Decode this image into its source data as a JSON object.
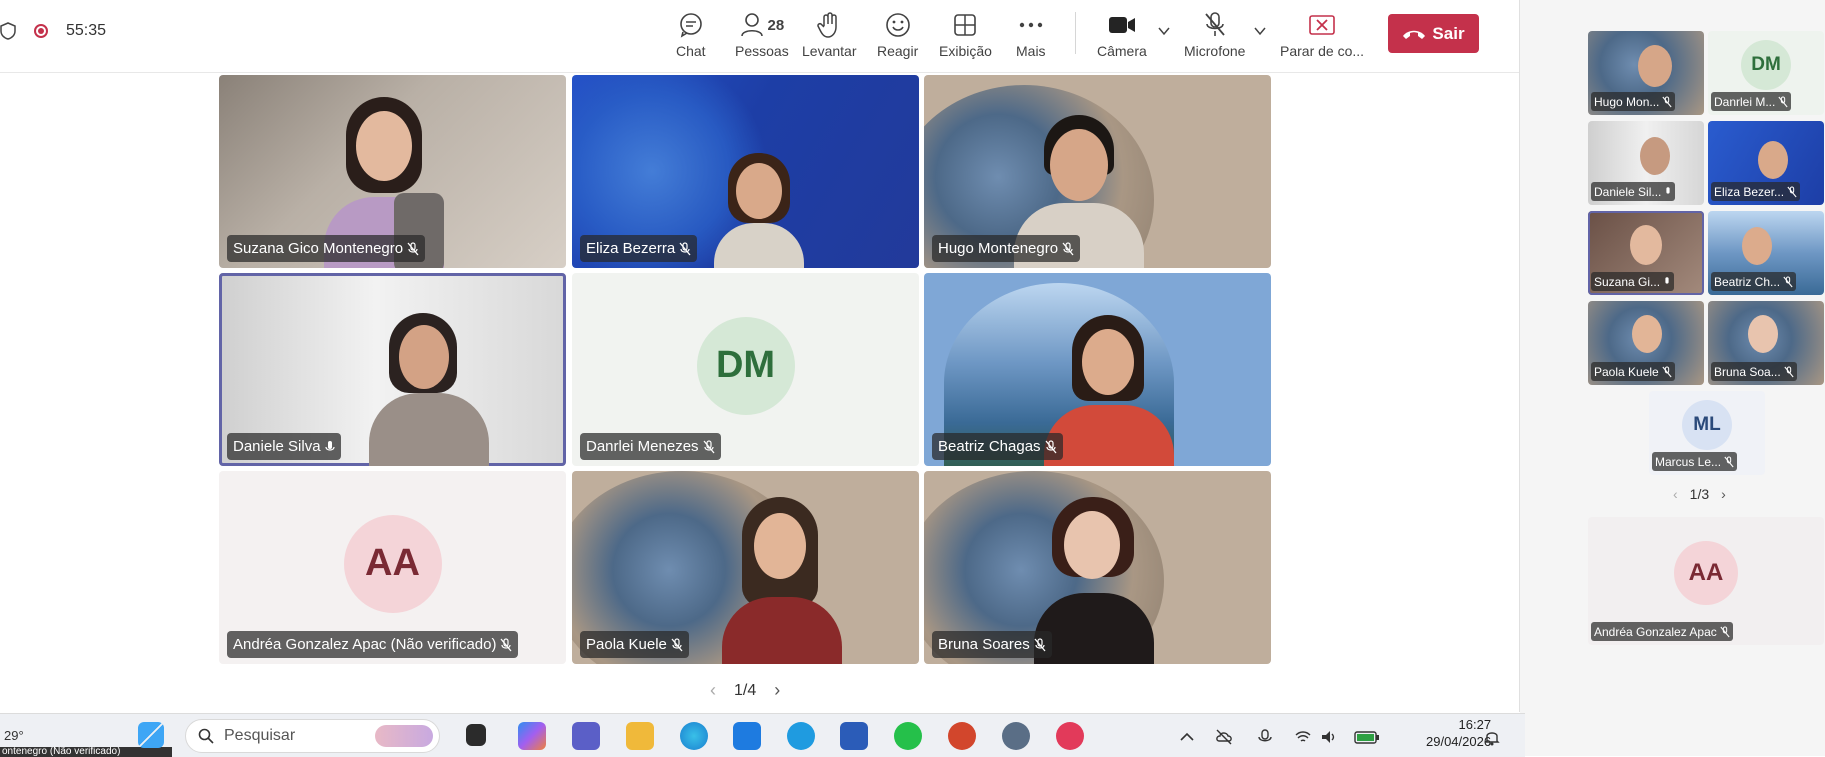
{
  "toolbar": {
    "timer": "55:35",
    "chat_label": "Chat",
    "people_label": "Pessoas",
    "people_count": "28",
    "raise_label": "Levantar",
    "react_label": "Reagir",
    "view_label": "Exibição",
    "more_label": "Mais",
    "camera_label": "Câmera",
    "mic_label": "Microfone",
    "stop_share_label": "Parar de co...",
    "leave_label": "Sair"
  },
  "grid": {
    "tiles": [
      {
        "name": "Suzana Gico Montenegro"
      },
      {
        "name": "Eliza Bezerra"
      },
      {
        "name": "Hugo Montenegro"
      },
      {
        "name": "Daniele Silva"
      },
      {
        "name": "Danrlei Menezes",
        "initials": "DM"
      },
      {
        "name": "Beatriz Chagas"
      },
      {
        "name": "Andréa Gonzalez Apac (Não verificado)",
        "initials": "AA"
      },
      {
        "name": "Paola Kuele"
      },
      {
        "name": "Bruna Soares"
      }
    ],
    "page": "1/4"
  },
  "rail": {
    "tiles": [
      {
        "name": "Hugo Mon..."
      },
      {
        "name": "Danrlei M...",
        "initials": "DM"
      },
      {
        "name": "Daniele Sil..."
      },
      {
        "name": "Eliza Bezer..."
      },
      {
        "name": "Suzana Gi..."
      },
      {
        "name": "Beatriz Ch..."
      },
      {
        "name": "Paola Kuele"
      },
      {
        "name": "Bruna Soa..."
      },
      {
        "name": "Marcus Le...",
        "initials": "ML"
      }
    ],
    "page": "1/3",
    "featured": {
      "name": "Andréa Gonzalez Apac",
      "initials": "AA"
    }
  },
  "taskbar": {
    "weather": "29°",
    "search_placeholder": "Pesquisar",
    "clock_time": "16:27",
    "clock_date": "29/04/2026",
    "strip_text": "ontenegro (Não verificado)"
  },
  "colors": {
    "leave": "#c4314b",
    "active_border": "#6264a7",
    "ocean": "#1f3fa8",
    "rock": "#b8a592"
  }
}
